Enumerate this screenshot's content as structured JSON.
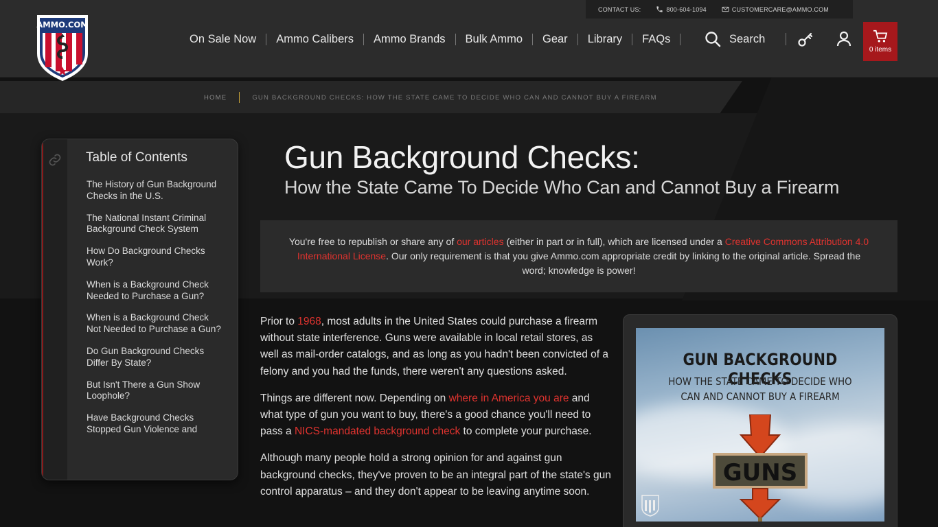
{
  "brand": {
    "name": "AMMO.COM",
    "colors": {
      "accent": "#a6181c",
      "link": "#e0332f",
      "breadcrumb_bar": "#c9a53a"
    }
  },
  "topbar": {
    "contact_label": "CONTACT US:",
    "phone": "800-604-1094",
    "email": "CUSTOMERCARE@AMMO.COM"
  },
  "nav": {
    "items": [
      "On Sale Now",
      "Ammo Calibers",
      "Ammo Brands",
      "Bulk Ammo",
      "Gear",
      "Library",
      "FAQs"
    ],
    "search_label": "Search",
    "cart_label": "0 items"
  },
  "breadcrumb": {
    "home": "HOME",
    "current": "GUN BACKGROUND CHECKS: HOW THE STATE CAME TO DECIDE WHO CAN AND CANNOT BUY A FIREARM"
  },
  "toc": {
    "title": "Table of Contents",
    "items": [
      "The History of Gun Background Checks in the U.S.",
      "The National Instant Criminal Background Check System",
      "How Do Background Checks Work?",
      "When is a Background Check Needed to Purchase a Gun?",
      "When is a Background Check Not Needed to Purchase a Gun?",
      "Do Gun Background Checks Differ By State?",
      "But Isn't There a Gun Show Loophole?",
      "Have Background Checks Stopped Gun Violence and"
    ]
  },
  "article": {
    "title": "Gun Background Checks:",
    "subtitle": "How the State Came To Decide Who Can and Cannot Buy a Firearm",
    "notice": {
      "t1": "You're free to republish or share any of ",
      "link1": "our articles",
      "t2": " (either in part or in full), which are licensed under a ",
      "link2": "Creative Commons Attribution 4.0 International License",
      "t3": ". Our only requirement is that you give Ammo.com appropriate credit by linking to the original article. Spread the word; knowledge is power!"
    },
    "p1": {
      "t1": "Prior to ",
      "link1": "1968",
      "t2": ", most adults in the United States could purchase a firearm without state interference. Guns were available in local retail stores, as well as mail-order catalogs, and as long as you hadn't been convicted of a felony and you had the funds, there weren't any questions asked."
    },
    "p2": {
      "t1": "Things are different now. Depending on ",
      "link1": "where in America you are",
      "t2": " and what type of gun you want to buy, there's a good chance you'll need to pass a ",
      "link2": "NICS-mandated background check",
      "t3": " to complete your purchase."
    },
    "p3": "Although many people hold a strong opinion for and against gun background checks, they've proven to be an integral part of the state's gun control apparatus – and they don't appear to be leaving anytime soon.",
    "image": {
      "title": "GUN BACKGROUND CHECKS",
      "subtitle_line1": "HOW THE STATE CAME TO DECIDE WHO",
      "subtitle_line2": "CAN AND CANNOT BUY A FIREARM",
      "sign_text": "GUNS"
    }
  }
}
